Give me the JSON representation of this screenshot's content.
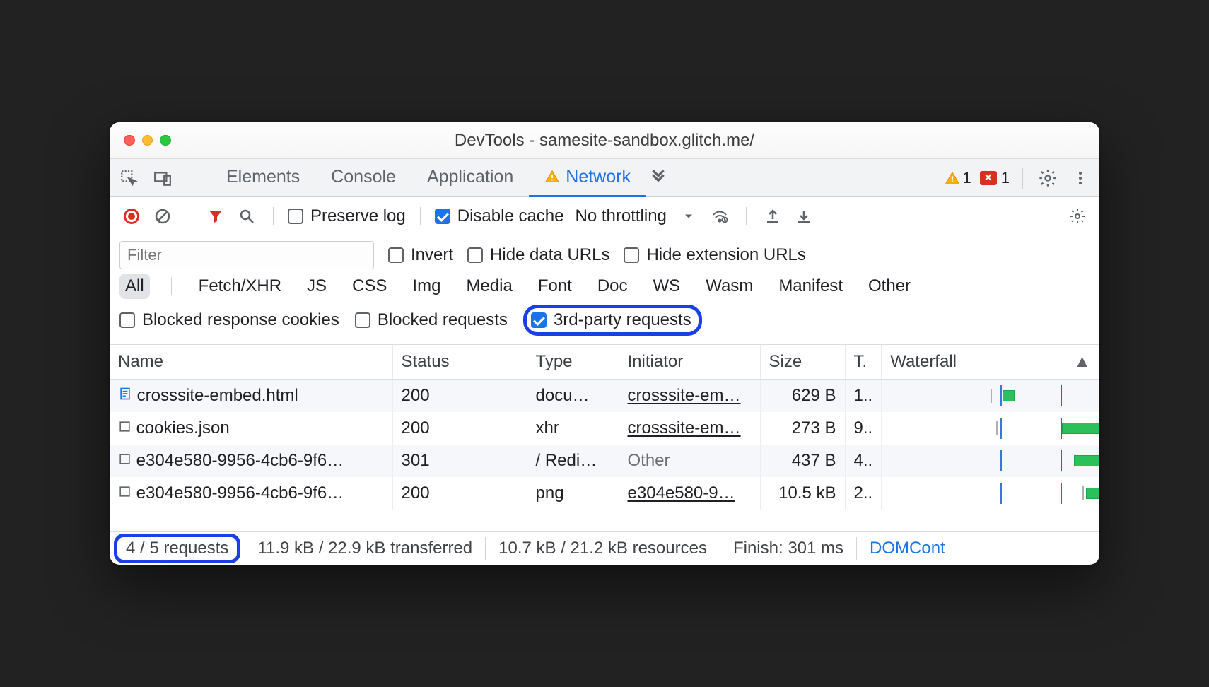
{
  "title": "DevTools - samesite-sandbox.glitch.me/",
  "tabs": {
    "elements": "Elements",
    "console": "Console",
    "application": "Application",
    "network": "Network"
  },
  "badges": {
    "warn": "1",
    "err": "1"
  },
  "toolbar": {
    "preserve_log": "Preserve log",
    "disable_cache": "Disable cache",
    "throttling": "No throttling"
  },
  "filter": {
    "placeholder": "Filter",
    "invert": "Invert",
    "hide_data": "Hide data URLs",
    "hide_ext": "Hide extension URLs"
  },
  "types": {
    "all": "All",
    "fetch": "Fetch/XHR",
    "js": "JS",
    "css": "CSS",
    "img": "Img",
    "media": "Media",
    "font": "Font",
    "doc": "Doc",
    "ws": "WS",
    "wasm": "Wasm",
    "manifest": "Manifest",
    "other": "Other"
  },
  "extra_filters": {
    "blocked_cookies": "Blocked response cookies",
    "blocked_req": "Blocked requests",
    "third_party": "3rd-party requests"
  },
  "headers": {
    "name": "Name",
    "status": "Status",
    "type": "Type",
    "initiator": "Initiator",
    "size": "Size",
    "time": "T.",
    "waterfall": "Waterfall"
  },
  "rows": [
    {
      "icon": "doc",
      "name": "crosssite-embed.html",
      "status": "200",
      "type": "docu…",
      "initiator": "crosssite-em…",
      "initClass": "underline",
      "size": "629 B",
      "time": "1.."
    },
    {
      "icon": "box",
      "name": "cookies.json",
      "status": "200",
      "type": "xhr",
      "initiator": "crosssite-em…",
      "initClass": "underline",
      "size": "273 B",
      "time": "9.."
    },
    {
      "icon": "box",
      "name": "e304e580-9956-4cb6-9f6…",
      "status": "301",
      "type": "/ Redi…",
      "initiator": "Other",
      "initClass": "muted",
      "size": "437 B",
      "time": "4.."
    },
    {
      "icon": "box",
      "name": "e304e580-9956-4cb6-9f6…",
      "status": "200",
      "type": "png",
      "initiator": "e304e580-9…",
      "initClass": "underline",
      "size": "10.5 kB",
      "time": "2.."
    }
  ],
  "status": {
    "requests": "4 / 5 requests",
    "transferred": "11.9 kB / 22.9 kB transferred",
    "resources": "10.7 kB / 21.2 kB resources",
    "finish": "Finish: 301 ms",
    "dom": "DOMCont"
  }
}
